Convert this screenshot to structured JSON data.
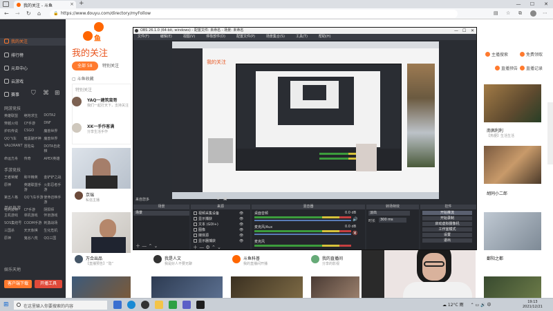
{
  "browser": {
    "tab_title": "我的关注 - 斗鱼",
    "url": "https://www.douyu.com/directory/myFollow"
  },
  "site": {
    "logo": "斗鱼",
    "sidebar": {
      "items": [
        "我的关注",
        "排行榜",
        "元旦中心",
        "云游戏",
        "赛事"
      ],
      "section_hot": "网游竞技",
      "hot_games": [
        "英雄联盟",
        "绝地求生",
        "DOTA2",
        "穿越火线",
        "CF手游",
        "DNF",
        "炉石传说",
        "CSGO",
        "魔兽世界",
        "QQ飞车",
        "暗黑破坏神",
        "魔兽世界",
        "VALORANT",
        "冒险岛",
        "DOTA自走棋",
        "命运方舟",
        "传奇",
        "APEX英雄"
      ],
      "section_mobile": "手游竞技",
      "mobile_games": [
        "王者荣耀",
        "和平精英",
        "金铲铲之战",
        "原神",
        "英雄联盟手游",
        "火影忍者手游",
        "第五人格",
        "QQ飞车手游",
        "使命召唤手游",
        "哈利波特",
        "CF手游",
        "阴阳师"
      ],
      "section_single": "单机热游",
      "single_games": [
        "主机游戏",
        "单机游戏",
        "怀旧游戏",
        "SOS集结号",
        "CODM手游",
        "刺激战场",
        "三国杀",
        "天天象棋",
        "生化危机",
        "原神",
        "鬼谷八荒",
        "QQ三国"
      ],
      "section_fun": "娱乐天地",
      "btn_download": "客户端下载",
      "btn_open": "开播工具"
    },
    "page_title": "我的关注",
    "tabs": [
      "全部 58",
      "特别关注"
    ],
    "fav_label": "斗鱼收藏",
    "section_label": "特别关注",
    "follows": [
      {
        "name": "YAQ一建筑蛮哥",
        "sub": "主播",
        "sub2": "我们一起打天下，支持关注"
      },
      {
        "name": "XK一手作客满",
        "sub": "主播",
        "sub2": "分享生活手作"
      }
    ],
    "cards": [
      {
        "title": "京瑞",
        "sub": "私信主播",
        "count": "1.1万"
      },
      {
        "title": "万合出品",
        "sub": "【直播预告】“隐”",
        "count": "3.2万"
      },
      {
        "title": "我是人文",
        "sub": "我是好人不要无聊",
        "count": "2.6万"
      },
      {
        "title": "斗鱼科普",
        "sub": "我的直播间开播",
        "count": "18.2万"
      },
      {
        "title": "我的直播间",
        "sub": "分享的影视",
        "count": "1.1万"
      }
    ],
    "right": {
      "links": [
        "主播搜索",
        "免费领取",
        "直播预告",
        "直播记录"
      ],
      "cards": [
        {
          "title": "南佩利利",
          "sub": "【热梗】生活生活"
        },
        {
          "title": "胡同小二郎",
          "sub": "千万别大意"
        },
        {
          "title": "鄱阳之都",
          "sub": "GRL超好看"
        }
      ]
    }
  },
  "obs": {
    "title": "OBS 26.1.0 (64-bit, windows) - 配置文件: 未命名 - 场景: 未命名",
    "menu": [
      "文件(F)",
      "编辑(E)",
      "视图(V)",
      "停靠部件(D)",
      "配置文件(P)",
      "场景集合(S)",
      "工具(T)",
      "帮助(H)"
    ],
    "scene_label": "来自您多",
    "docks": {
      "scenes": "场景",
      "sources": "来源",
      "mixer": "混音器",
      "transitions": "转场特效",
      "controls": "控件"
    },
    "scenes": [
      "场景"
    ],
    "sources": [
      "视频采集设备",
      "显示捕获",
      "文本 (GDI+)",
      "图像",
      "媒体源",
      "显示器捕获"
    ],
    "mixer": [
      {
        "name": "桌面音频",
        "db": "0.0 dB"
      },
      {
        "name": "麦克风/Aux",
        "db": "0.0 dB"
      },
      {
        "name": "麦克风",
        "db": "0.0 dB"
      }
    ],
    "transition": {
      "type": "淡出",
      "duration_label": "时长",
      "duration": "300 ms"
    },
    "controls": [
      "开始推流",
      "开始录制",
      "启动虚拟摄像机",
      "工作室模式",
      "设置",
      "退出"
    ],
    "status": "LIVE: 00:00:00  REC: 00:00:00  CPU: 3.4%, 30.00 fps"
  },
  "taskbar": {
    "search_placeholder": "在这里输入你要搜索的内容",
    "weather": "12°C 雨",
    "ime": "中",
    "time": "19:13",
    "date": "2021/12/21"
  },
  "colors": {
    "brand": "#ff7a2e",
    "sidebar": "#2b2d33",
    "obs_bg": "#2a2d33"
  }
}
